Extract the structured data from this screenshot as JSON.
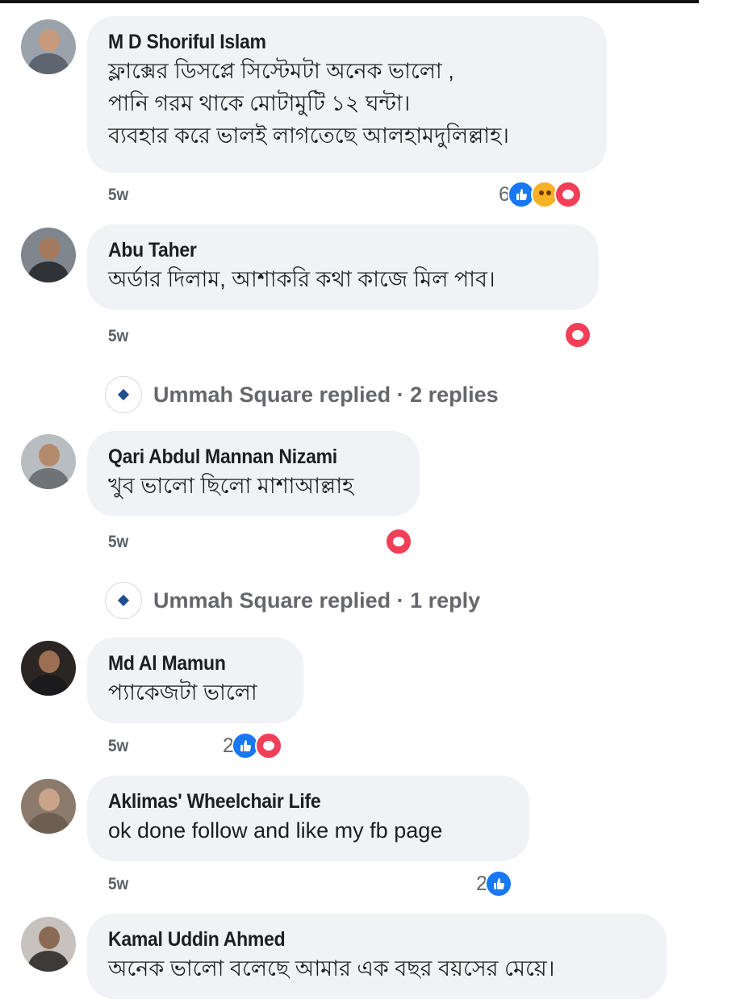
{
  "comments": [
    {
      "author": "M D Shoriful Islam",
      "lines": [
        "ফ্লাক্সের ডিসপ্লে সিস্টেমটা অনেক ভালো ,",
        "পানি গরম থাকে মোটামুটি ১২ ঘন্টা।",
        "ব্যবহার করে ভালই লাগতেছে আলহামদুলিল্লাহ।"
      ],
      "time": "5w",
      "reaction_count": "6",
      "reactions": [
        "like-icon",
        "care-icon",
        "love-icon"
      ]
    },
    {
      "author": "Abu Taher",
      "lines": [
        "অর্ডার দিলাম, আশাকরি কথা কাজে মিল পাব।"
      ],
      "time": "5w",
      "reaction_count": "",
      "reactions": [
        "love-icon"
      ]
    },
    {
      "author": "Qari Abdul Mannan Nizami",
      "lines": [
        "খুব ভালো ছিলো মাশাআল্লাহ"
      ],
      "time": "5w",
      "reaction_count": "",
      "reactions": [
        "love-icon"
      ]
    },
    {
      "author": "Md Al Mamun",
      "lines": [
        "প্যাকেজটা ভালো"
      ],
      "time": "5w",
      "reaction_count": "2",
      "reactions": [
        "like-icon",
        "love-icon"
      ]
    },
    {
      "author": "Aklimas' Wheelchair Life",
      "lines": [
        "ok done follow and like my fb page"
      ],
      "time": "5w",
      "reaction_count": "2",
      "reactions": [
        "like-icon"
      ]
    },
    {
      "author": "Kamal Uddin Ahmed",
      "lines": [
        "অনেক ভালো বলেছে আমার এক বছর বয়সের মেয়ে।"
      ]
    }
  ],
  "replies": [
    {
      "text": "Ummah Square replied · 2 replies"
    },
    {
      "text": "Ummah Square replied · 1 reply"
    }
  ],
  "colors": {
    "bubble": "#f0f2f5",
    "like": "#1877f2",
    "love": "#f33e58",
    "care": "#f7b125",
    "secondary_text": "#65676b"
  }
}
